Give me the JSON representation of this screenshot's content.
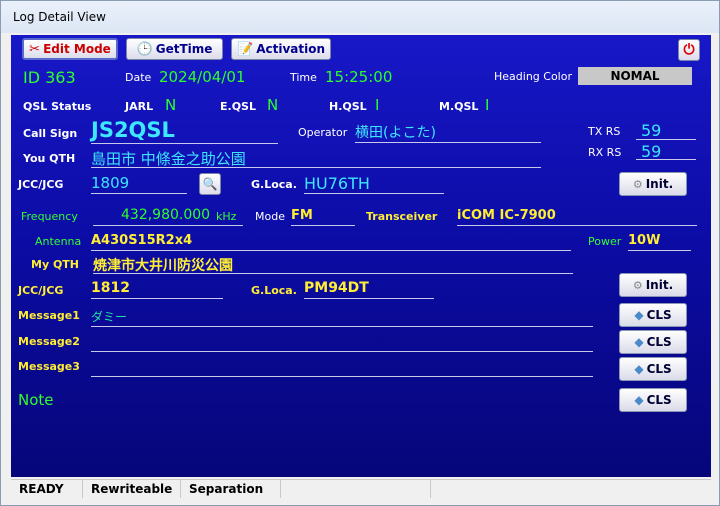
{
  "window": {
    "title": "Log Detail View"
  },
  "toolbar": {
    "edit_mode": "Edit Mode",
    "get_time": "GetTime",
    "activation": "Activation"
  },
  "header": {
    "id": "ID 363",
    "date_label": "Date",
    "date": "2024/04/01",
    "time_label": "Time",
    "time": "15:25:00",
    "heading_color_label": "Heading Color",
    "heading_color_value": "NOMAL"
  },
  "qsl": {
    "status_label": "QSL Status",
    "jarl_label": "JARL",
    "jarl_value": "N",
    "eqsl_label": "E.QSL",
    "eqsl_value": "N",
    "hqsl_label": "H.QSL",
    "hqsl_value": "I",
    "mqsl_label": "M.QSL",
    "mqsl_value": "I"
  },
  "station": {
    "callsign_label": "Call Sign",
    "callsign": "JS2QSL",
    "operator_label": "Operator",
    "operator": "横田(よこた)",
    "tx_rs_label": "TX RS",
    "tx_rs": "59",
    "rx_rs_label": "RX RS",
    "rx_rs": "59",
    "qth_label": "You QTH",
    "qth": "島田市 中條金之助公園",
    "jcc_label": "JCC/JCG",
    "jcc": "1809",
    "gloca_label": "G.Loca.",
    "gloca": "HU76TH",
    "init_label": "Init."
  },
  "radio": {
    "frequency_label": "Frequency",
    "frequency": "432,980.000",
    "freq_unit": "kHz",
    "mode_label": "Mode",
    "mode": "FM",
    "transceiver_label": "Transceiver",
    "transceiver": "iCOM IC-7900",
    "antenna_label": "Antenna",
    "antenna": "A430S15R2x4",
    "power_label": "Power",
    "power": "10W"
  },
  "my": {
    "qth_label": "My QTH",
    "qth": "焼津市大井川防災公園",
    "jcc_label": "JCC/JCG",
    "jcc": "1812",
    "gloca_label": "G.Loca.",
    "gloca": "PM94DT",
    "init_label": "Init."
  },
  "messages": {
    "m1_label": "Message1",
    "m1": "ダミー",
    "m2_label": "Message2",
    "m2": "",
    "m3_label": "Message3",
    "m3": "",
    "note_label": "Note",
    "cls_label": "CLS"
  },
  "statusbar": {
    "ready": "READY",
    "rewriteable": "Rewriteable",
    "separation": "Separation"
  },
  "colors": {
    "panel": "#0c0ca6",
    "green": "#2cff2c",
    "cyan": "#3ee6ff",
    "yellow": "#ffee33"
  },
  "icons": {
    "edit": "scissors-icon",
    "get_time": "clock-icon",
    "activation": "checklist-icon",
    "power": "power-icon",
    "search": "globe-search-icon",
    "init": "gear-icon",
    "cls": "diamond-arrow-icon"
  }
}
